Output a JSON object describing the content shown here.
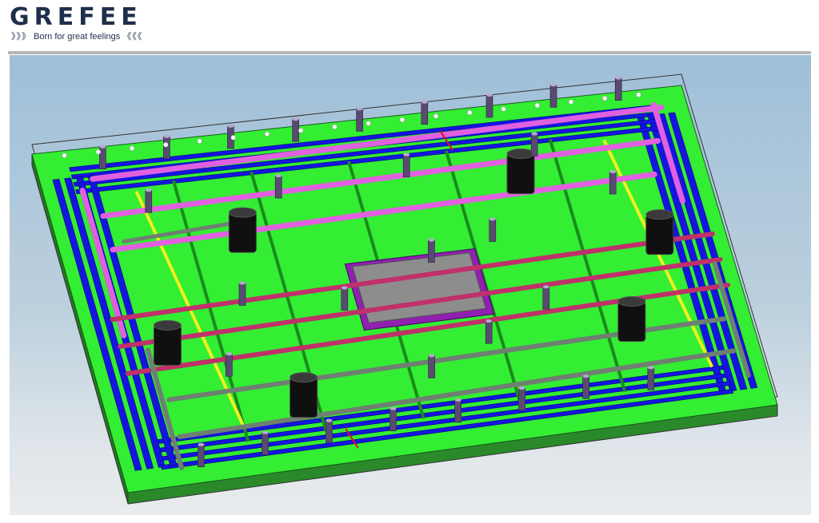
{
  "header": {
    "logo_text": "GREFEE",
    "tagline": {
      "left_chevrons": "》》》",
      "text": "Born for great feelings",
      "right_chevrons": "《《《"
    }
  },
  "viewport": {
    "content": "3D mold cooling-channel model",
    "colors": {
      "plate_green": "#33ee33",
      "channel_blue": "#1515e0",
      "channel_magenta": "#e060e0",
      "channel_crimson": "#c0306a",
      "channel_gray": "#6f7f72",
      "ejector_yellow": "#f0f020",
      "insert_gray": "#8d8d8d",
      "insert_frame": "#9020b0",
      "post": "#5a4a72"
    }
  }
}
